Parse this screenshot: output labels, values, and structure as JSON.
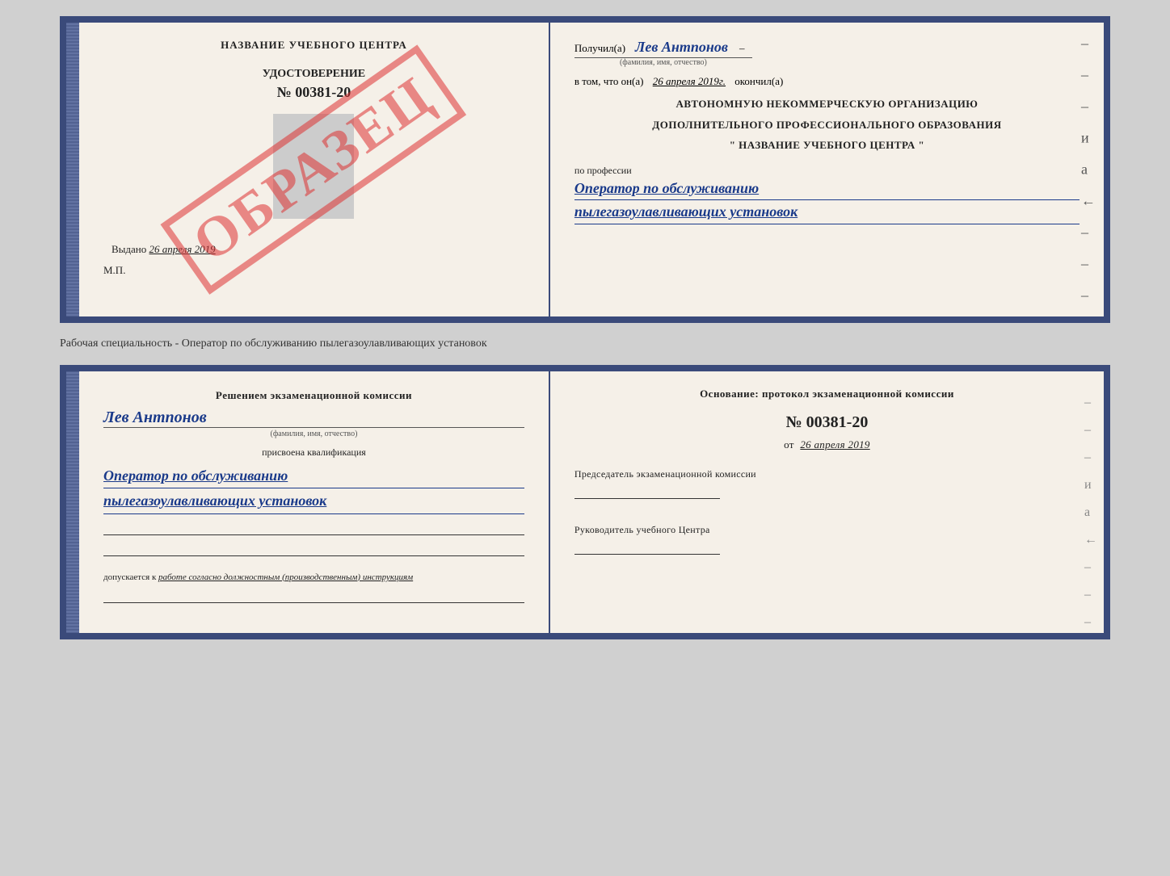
{
  "top_book": {
    "left": {
      "title": "НАЗВАНИЕ УЧЕБНОГО ЦЕНТРА",
      "id_label": "УДОСТОВЕРЕНИЕ",
      "id_number": "№ 00381-20",
      "obrazets": "ОБРАЗЕЦ",
      "issued_label": "Выдано",
      "issued_date": "26 апреля 2019",
      "mp": "М.П."
    },
    "right": {
      "received_label": "Получил(а)",
      "received_name": "Лев Антпонов",
      "fio_note": "(фамилия, имя, отчество)",
      "in_that_label": "в том, что он(а)",
      "in_that_date": "26 апреля 2019г.",
      "finished_label": "окончил(а)",
      "org_line1": "АВТОНОМНУЮ НЕКОММЕРЧЕСКУЮ ОРГАНИЗАЦИЮ",
      "org_line2": "ДОПОЛНИТЕЛЬНОГО ПРОФЕССИОНАЛЬНОГО ОБРАЗОВАНИЯ",
      "org_name": "\"  НАЗВАНИЕ УЧЕБНОГО ЦЕНТРА  \"",
      "profession_label": "по профессии",
      "profession_line1": "Оператор по обслуживанию",
      "profession_line2": "пылегазоулавливающих установок",
      "dashes": [
        "–",
        "–",
        "–",
        "и",
        "а",
        "←",
        "–",
        "–",
        "–"
      ]
    }
  },
  "separator": {
    "text": "Рабочая специальность - Оператор по обслуживанию пылегазоулавливающих установок"
  },
  "bottom_book": {
    "left": {
      "decision": "Решением экзаменационной комиссии",
      "name": "Лев Антпонов",
      "fio_note": "(фамилия, имя, отчество)",
      "assigned_label": "присвоена квалификация",
      "qualification_line1": "Оператор по обслуживанию",
      "qualification_line2": "пылегазоулавливающих установок",
      "allowed_label": "допускается к",
      "allowed_text": "работе согласно должностным (производственным) инструкциям"
    },
    "right": {
      "basis_label": "Основание: протокол экзаменационной комиссии",
      "protocol_num": "№ 00381-20",
      "protocol_date_prefix": "от",
      "protocol_date": "26 апреля 2019",
      "chairman_label": "Председатель экзаменационной комиссии",
      "director_label": "Руководитель учебного Центра",
      "dashes": [
        "–",
        "–",
        "–",
        "и",
        "а",
        "←",
        "–",
        "–",
        "–"
      ]
    }
  }
}
